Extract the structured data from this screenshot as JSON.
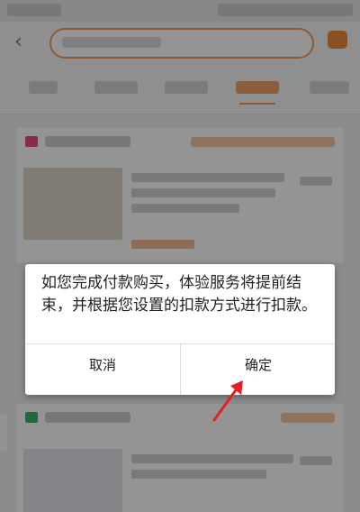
{
  "dialog": {
    "message": "如您完成付款购买，体验服务将提前结束，并根据您设置的扣款方式进行扣款。",
    "cancel_label": "取消",
    "confirm_label": "确定"
  },
  "colors": {
    "accent": "#f39a5a",
    "annotation_arrow": "#e31f1f",
    "scrim": "#000000"
  }
}
